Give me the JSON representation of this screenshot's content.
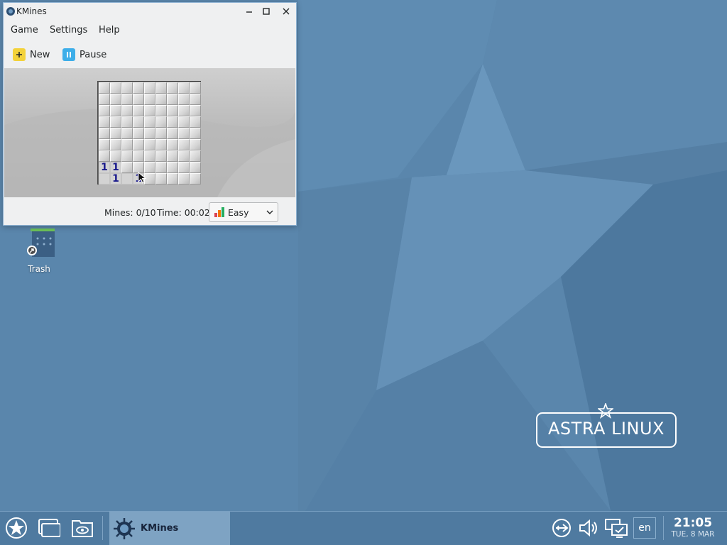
{
  "window": {
    "title": "KMines",
    "menu": [
      "Game",
      "Settings",
      "Help"
    ],
    "toolbar": {
      "new_label": "New",
      "pause_label": "Pause"
    },
    "status": {
      "mines": "Mines: 0/10",
      "time": "Time: 00:02",
      "difficulty": "Easy"
    },
    "board": {
      "cols": 9,
      "rows": 9,
      "revealed": [
        {
          "row": 7,
          "col": 0,
          "text": "1"
        },
        {
          "row": 7,
          "col": 1,
          "text": "1"
        },
        {
          "row": 8,
          "col": 0,
          "text": ""
        },
        {
          "row": 8,
          "col": 1,
          "text": "1"
        },
        {
          "row": 8,
          "col": 2,
          "text": ""
        },
        {
          "row": 8,
          "col": 3,
          "text": "1"
        }
      ]
    }
  },
  "desktop": {
    "icons": [
      {
        "label": "Trash",
        "icon": "trash-icon"
      }
    ],
    "logo_text": "ASTRA LINUX"
  },
  "taskbar": {
    "task_label": "KMines",
    "language": "en",
    "time": "21:05",
    "date": "TUE, 8 MAR",
    "icons": [
      "start-menu-icon",
      "windows-icon",
      "file-manager-icon",
      "network-icon",
      "volume-icon",
      "display-icon"
    ]
  },
  "colors": {
    "desktop": "#5a86ac",
    "taskbar": "#4f7aa0",
    "active_task": "#7ea3c3",
    "number": "#1a1a8c"
  }
}
